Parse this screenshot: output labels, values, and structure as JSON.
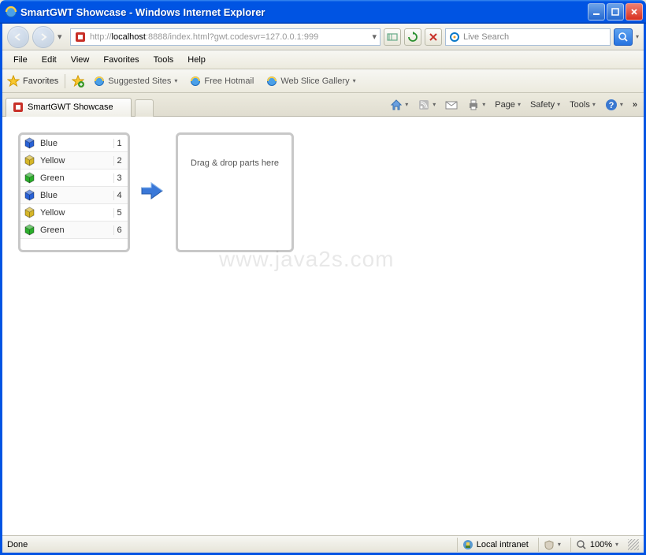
{
  "window": {
    "title": "SmartGWT Showcase - Windows Internet Explorer"
  },
  "address": {
    "prefix": "http://",
    "host": "localhost",
    "rest": ":8888/index.html?gwt.codesvr=127.0.0.1:999"
  },
  "search": {
    "placeholder": "Live Search"
  },
  "menu": {
    "file": "File",
    "edit": "Edit",
    "view": "View",
    "favorites": "Favorites",
    "tools": "Tools",
    "help": "Help"
  },
  "favbar": {
    "favorites": "Favorites",
    "suggested": "Suggested Sites",
    "free_hotmail": "Free Hotmail",
    "webslice": "Web Slice Gallery"
  },
  "tab": {
    "title": "SmartGWT Showcase"
  },
  "cmd": {
    "page": "Page",
    "safety": "Safety",
    "tools": "Tools"
  },
  "list": {
    "rows": [
      {
        "color": "#2861d6",
        "label": "Blue",
        "num": "1"
      },
      {
        "color": "#d6b628",
        "label": "Yellow",
        "num": "2"
      },
      {
        "color": "#2bae2b",
        "label": "Green",
        "num": "3"
      },
      {
        "color": "#2861d6",
        "label": "Blue",
        "num": "4"
      },
      {
        "color": "#d6b628",
        "label": "Yellow",
        "num": "5"
      },
      {
        "color": "#2bae2b",
        "label": "Green",
        "num": "6"
      }
    ]
  },
  "dropzone": {
    "text": "Drag & drop parts here"
  },
  "watermark": "www.java2s.com",
  "status": {
    "done": "Done",
    "zone": "Local intranet",
    "zoom": "100%"
  }
}
